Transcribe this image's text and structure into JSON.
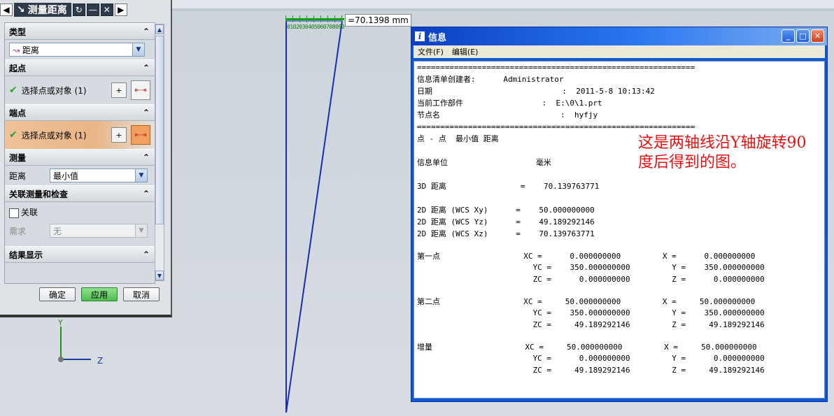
{
  "dialog": {
    "title": "测量距离",
    "sections": {
      "type": {
        "header": "类型",
        "combo_value": "距离"
      },
      "start": {
        "header": "起点",
        "select_label": "选择点或对象 (1)"
      },
      "end": {
        "header": "端点",
        "select_label": "选择点或对象 (1)"
      },
      "measure": {
        "header": "测量",
        "label": "距离",
        "combo_value": "最小值"
      },
      "assoc": {
        "header": "关联测量和检查",
        "checkbox_label": "关联",
        "req_label": "需求",
        "req_value": "无"
      },
      "result": {
        "header": "结果显示"
      }
    },
    "buttons": {
      "ok": "确定",
      "apply": "应用",
      "cancel": "取消"
    }
  },
  "viewport": {
    "distance_label": "=70.1398 mm",
    "ruler_labels": "0102030405060708090100",
    "axis_y": "Y",
    "axis_z": "Z",
    "colors": {
      "measure_line": "#1a2db0",
      "ruler": "#14a014",
      "axis_y": "#2a8a2a",
      "axis_z": "#1a3fa0"
    }
  },
  "info_window": {
    "title": "信息",
    "menu": {
      "file": "文件(F)",
      "edit": "编辑(E)"
    },
    "lines": [
      "============================================================",
      "信息清单创建者:      Administrator",
      "日期                            :  2011-5-8 10:13:42",
      "当前工作部件                 :  E:\\0\\1.prt",
      "节点名                          :  hyfjy",
      "============================================================",
      "点 - 点  最小值 距离",
      "",
      "信息单位                   毫米",
      "",
      "3D 距离                =    70.139763771",
      "",
      "2D 距离 (WCS Xy)      =    50.000000000",
      "2D 距离 (WCS Yz)      =    49.189292146",
      "2D 距离 (WCS Xz)      =    70.139763771",
      "",
      "第一点                  XC =      0.000000000         X =      0.000000000",
      "                         YC =    350.000000000         Y =    350.000000000",
      "                         ZC =      0.000000000         Z =      0.000000000",
      "",
      "第二点                  XC =     50.000000000         X =     50.000000000",
      "                         YC =    350.000000000         Y =    350.000000000",
      "                         ZC =     49.189292146         Z =     49.189292146",
      "",
      "增量                    XC =     50.000000000         X =     50.000000000",
      "                         YC =      0.000000000         Y =      0.000000000",
      "                         ZC =     49.189292146         Z =     49.189292146"
    ],
    "annotation": "这是两轴线沿Y轴旋转90度后得到的图。"
  }
}
